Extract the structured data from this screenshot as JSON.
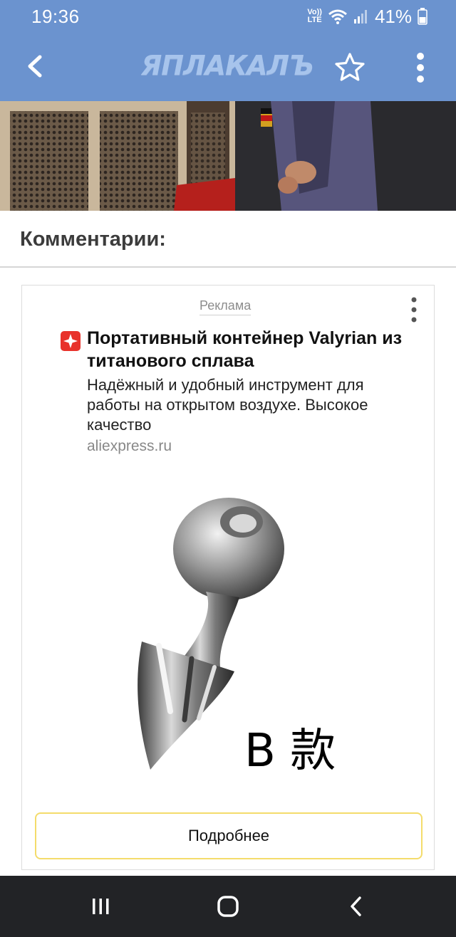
{
  "status_bar": {
    "time": "19:36",
    "network_top": "Vo))",
    "network_bottom": "LTE",
    "battery": "41%"
  },
  "app_bar": {
    "logo": "ЯПЛАКАЛЪ",
    "back_icon": "chevron-left-icon",
    "favorite_icon": "star-outline-icon",
    "menu_icon": "more-vertical-icon",
    "color": "#6b93cf"
  },
  "comments": {
    "title": "Комментарии:"
  },
  "ad": {
    "label": "Реклама",
    "title": "Портативный контейнер Valyrian из титанового сплава",
    "description": "Надёжный и удобный инструмент для работы на открытом воздухе. Высокое качество",
    "domain": "aliexpress.ru",
    "image_badge": "B 款",
    "cta": "Подробнее",
    "favicon_color": "#e8322b",
    "cta_border_color": "#f4dc6b"
  },
  "nav_bar": {
    "recent_icon": "recent-apps-icon",
    "home_icon": "home-icon",
    "back_icon": "back-icon"
  }
}
